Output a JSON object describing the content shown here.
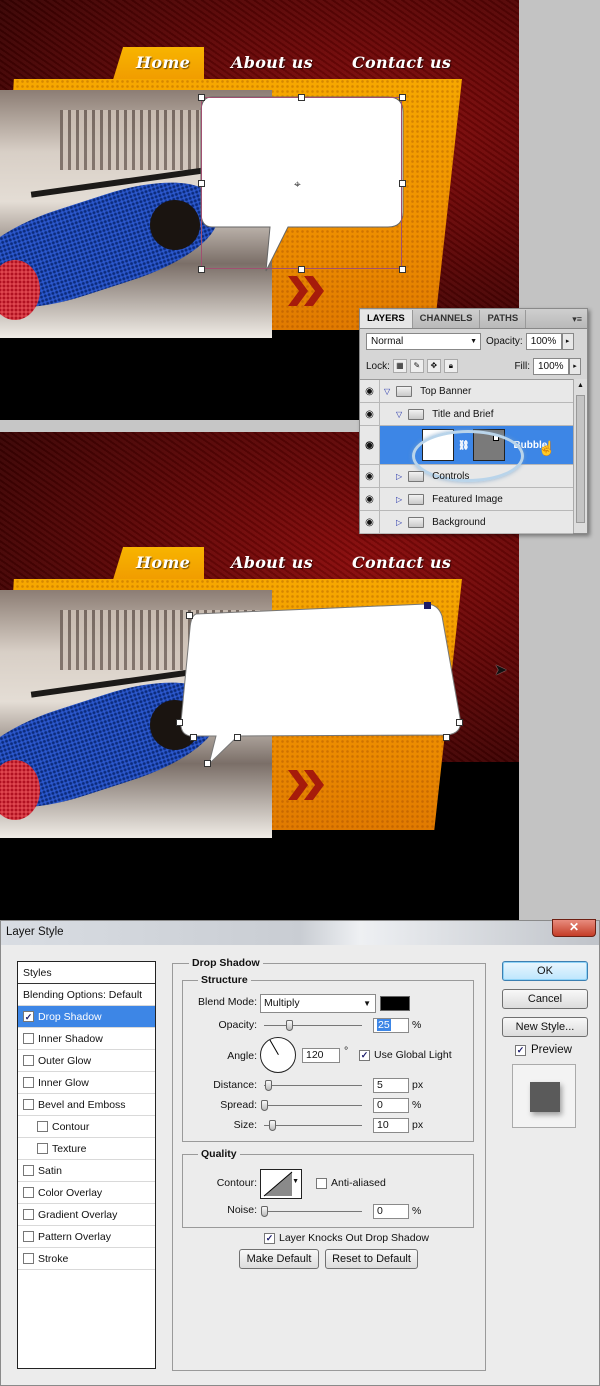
{
  "nav": {
    "home": "Home",
    "about": "About us",
    "contact": "Contact us"
  },
  "layers_panel": {
    "tabs": [
      "LAYERS",
      "CHANNELS",
      "PATHS"
    ],
    "menu_glyph": "▾≡",
    "blend_mode": "Normal",
    "opacity_label": "Opacity:",
    "opacity_value": "100%",
    "lock_label": "Lock:",
    "fill_label": "Fill:",
    "fill_value": "100%",
    "layers": [
      {
        "name": "Top Banner",
        "expanded": true
      },
      {
        "name": "Title and Brief",
        "expanded": true
      },
      {
        "name": "Bubble",
        "selected": true
      },
      {
        "name": "Controls",
        "expanded": false
      },
      {
        "name": "Featured Image",
        "expanded": false
      },
      {
        "name": "Background",
        "expanded": false
      }
    ]
  },
  "dialog": {
    "title": "Layer Style",
    "close_glyph": "✕",
    "styles": {
      "header": "Styles",
      "blending": "Blending Options: Default",
      "items": [
        {
          "label": "Drop Shadow",
          "checked": true,
          "selected": true
        },
        {
          "label": "Inner Shadow",
          "checked": false
        },
        {
          "label": "Outer Glow",
          "checked": false
        },
        {
          "label": "Inner Glow",
          "checked": false
        },
        {
          "label": "Bevel and Emboss",
          "checked": false
        },
        {
          "label": "Contour",
          "checked": false,
          "indent": true
        },
        {
          "label": "Texture",
          "checked": false,
          "indent": true
        },
        {
          "label": "Satin",
          "checked": false
        },
        {
          "label": "Color Overlay",
          "checked": false
        },
        {
          "label": "Gradient Overlay",
          "checked": false
        },
        {
          "label": "Pattern Overlay",
          "checked": false
        },
        {
          "label": "Stroke",
          "checked": false
        }
      ]
    },
    "drop_shadow": {
      "section_title": "Drop Shadow",
      "structure_title": "Structure",
      "blend_mode_label": "Blend Mode:",
      "blend_mode": "Multiply",
      "shadow_color": "#000000",
      "opacity_label": "Opacity:",
      "opacity": "25",
      "angle_label": "Angle:",
      "angle": "120",
      "degree": "°",
      "use_global_light": "Use Global Light",
      "distance_label": "Distance:",
      "distance": "5",
      "spread_label": "Spread:",
      "spread": "0",
      "size_label": "Size:",
      "size": "10",
      "unit_px": "px",
      "unit_pct": "%",
      "quality_title": "Quality",
      "contour_label": "Contour:",
      "anti_aliased": "Anti-aliased",
      "noise_label": "Noise:",
      "noise": "0",
      "knocks_out": "Layer Knocks Out Drop Shadow",
      "make_default": "Make Default",
      "reset_default": "Reset to Default"
    },
    "buttons": {
      "ok": "OK",
      "cancel": "Cancel",
      "new_style": "New Style...",
      "preview": "Preview"
    }
  },
  "colors": {
    "accent_blue": "#3d86e6",
    "banner_orange": "#f09a00",
    "banner_red": "#6a0606"
  }
}
